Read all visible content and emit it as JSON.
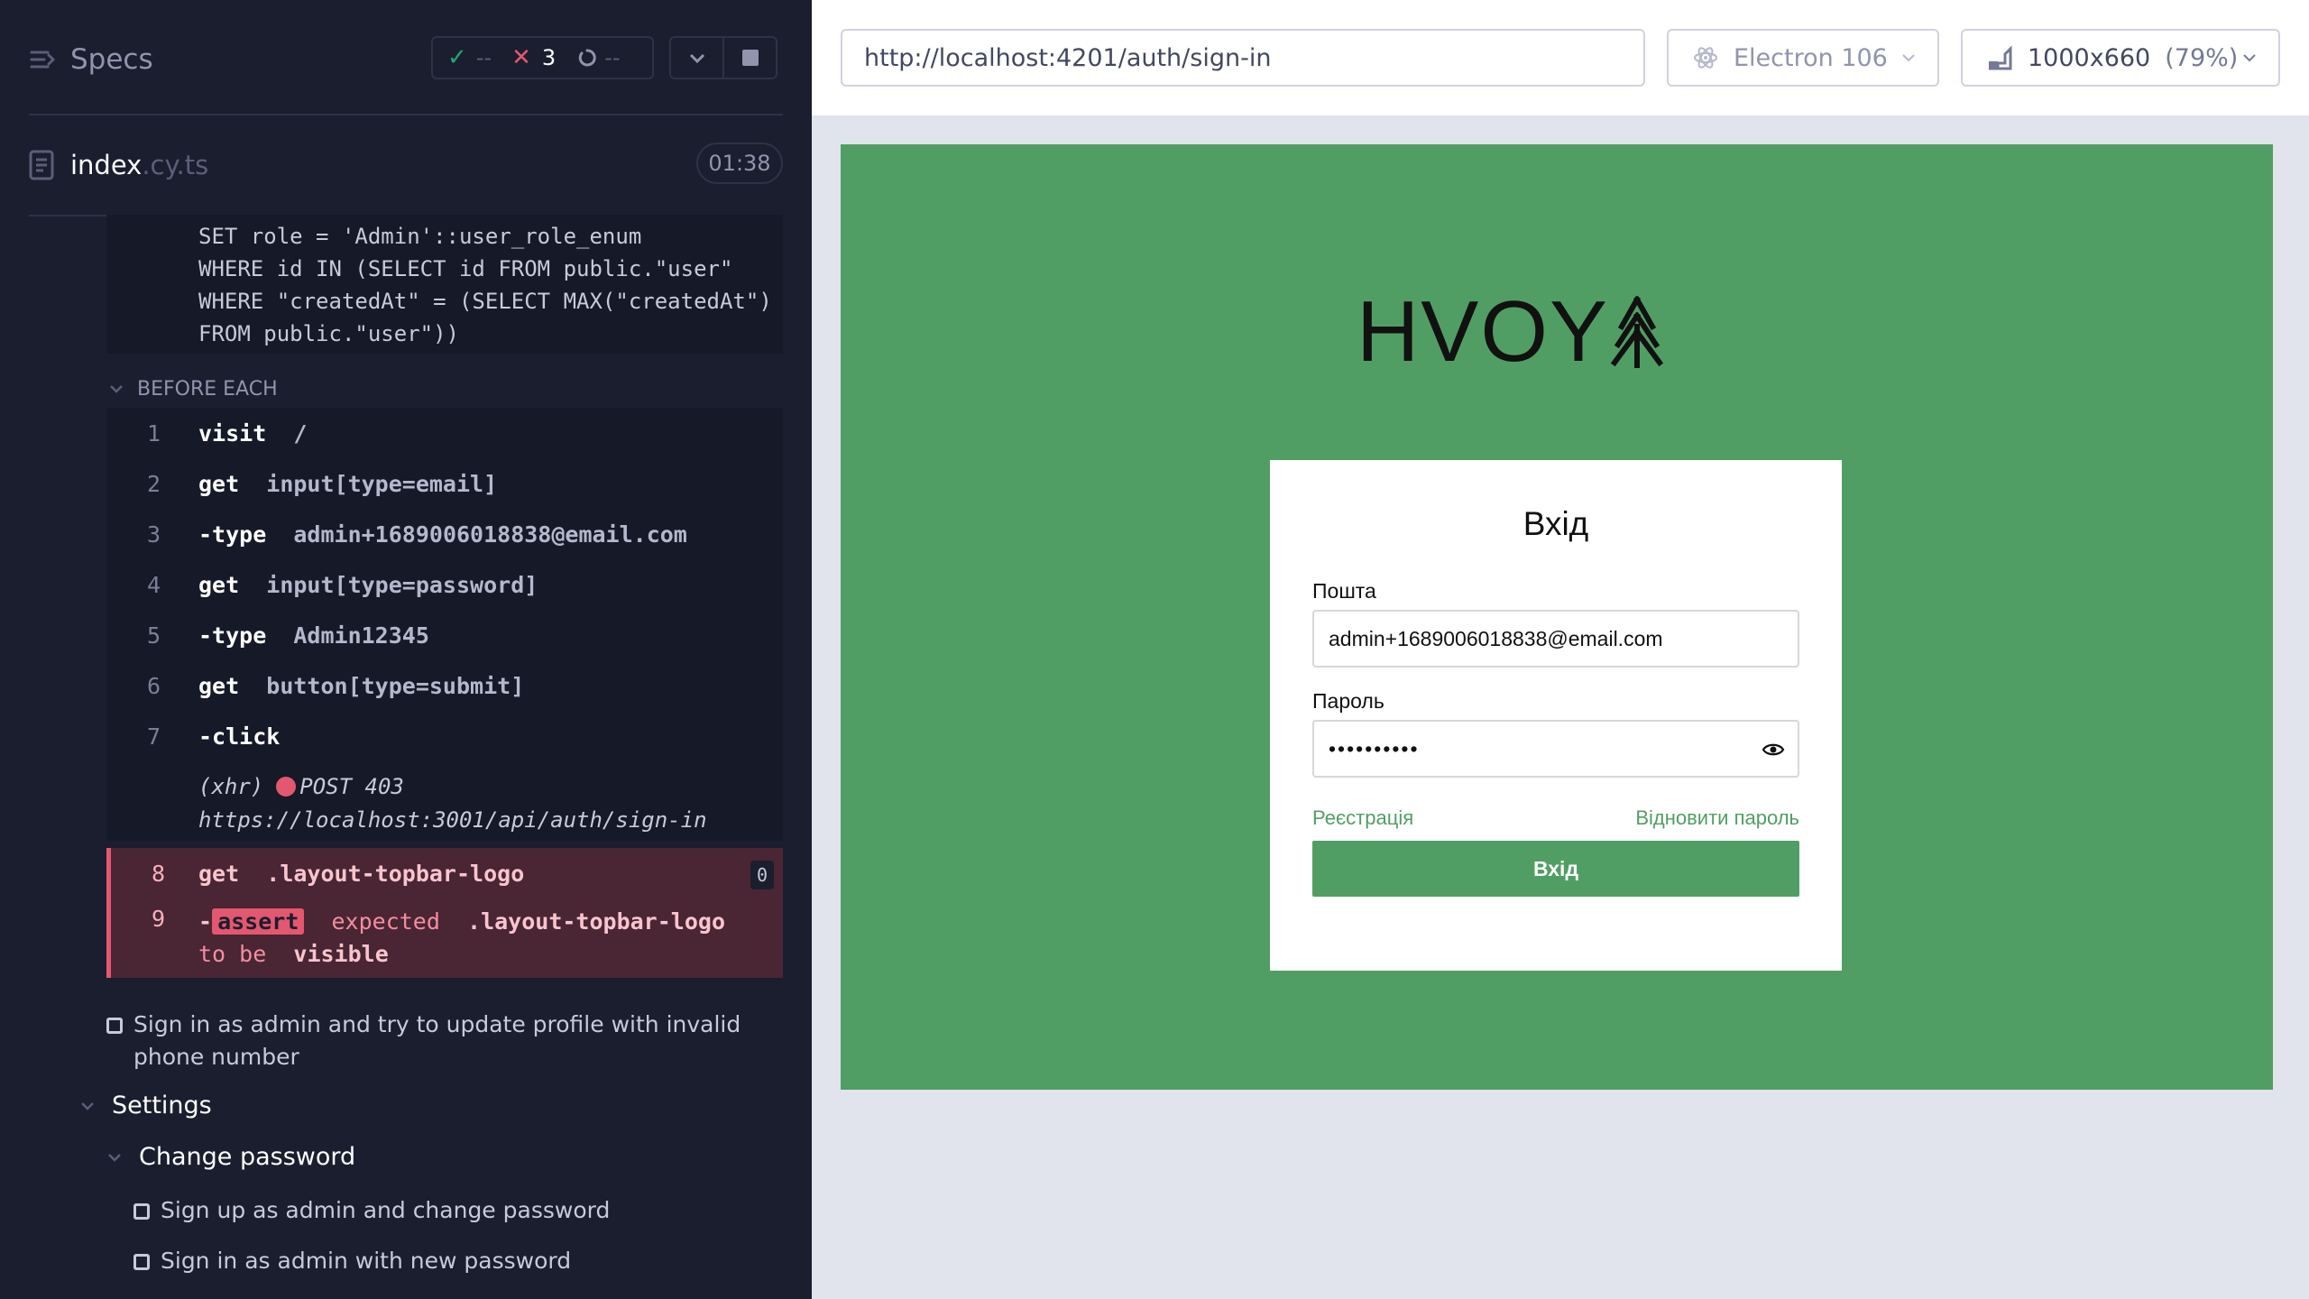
{
  "runner": {
    "title": "Specs",
    "stats": {
      "passed": "--",
      "failed": "3",
      "pending": "--"
    },
    "file": {
      "name": "index",
      "ext": ".cy.ts"
    },
    "timer": "01:38",
    "sql_lines": [
      "SET role = 'Admin'::user_role_enum",
      "WHERE id IN (SELECT id FROM public.\"user\"",
      "WHERE \"createdAt\" = (SELECT MAX(\"createdAt\")",
      "FROM public.\"user\"))"
    ],
    "before_each_label": "BEFORE EACH",
    "commands": [
      {
        "num": "1",
        "name": "visit",
        "arg": "/"
      },
      {
        "num": "2",
        "name": "get",
        "arg": "input[type=email]"
      },
      {
        "num": "3",
        "name": "-type",
        "arg": "admin+1689006018838@email.com"
      },
      {
        "num": "4",
        "name": "get",
        "arg": "input[type=password]"
      },
      {
        "num": "5",
        "name": "-type",
        "arg": "Admin12345"
      },
      {
        "num": "6",
        "name": "get",
        "arg": "button[type=submit]"
      },
      {
        "num": "7",
        "name": "-click",
        "arg": ""
      }
    ],
    "xhr": {
      "prefix": "(xhr)",
      "status": "POST 403",
      "url": "https://localhost:3001/api/auth/sign-in"
    },
    "error_commands": {
      "cmd8": {
        "num": "8",
        "name": "get",
        "arg": ".layout-topbar-logo",
        "badge": "0"
      },
      "cmd9": {
        "num": "9",
        "dash": "-",
        "tag": "assert",
        "w1": "expected",
        "selector": ".layout-topbar-logo",
        "w2": "to",
        "w3": "be",
        "w4": "visible"
      }
    },
    "tests": {
      "t1": "Sign in as admin and try to update profile with invalid phone number",
      "suite_settings": "Settings",
      "suite_change_password": "Change password",
      "t2": "Sign up as admin and change password",
      "t3": "Sign in as admin with new password"
    }
  },
  "browser_bar": {
    "url": "http://localhost:4201/auth/sign-in",
    "browser": "Electron 106",
    "viewport": "1000x660",
    "scale": "(79%)"
  },
  "app": {
    "logo": "HVOY",
    "card_title": "Вхід",
    "email_label": "Пошта",
    "email_value": "admin+1689006018838@email.com",
    "password_label": "Пароль",
    "password_value": "••••••••••",
    "register_link": "Реєстрація",
    "restore_link": "Відновити пароль",
    "submit_label": "Вхід"
  },
  "colors": {
    "runner_bg": "#1b1e2e",
    "app_green": "#519e64",
    "error_pink": "#e45770",
    "pass_green": "#1fa971"
  },
  "icons": [
    "specs-icon",
    "check-icon",
    "x-icon",
    "spinner-icon",
    "chevron-down-icon",
    "stop-icon",
    "file-icon",
    "electron-icon",
    "viewport-icon",
    "tree-icon",
    "eye-icon"
  ]
}
